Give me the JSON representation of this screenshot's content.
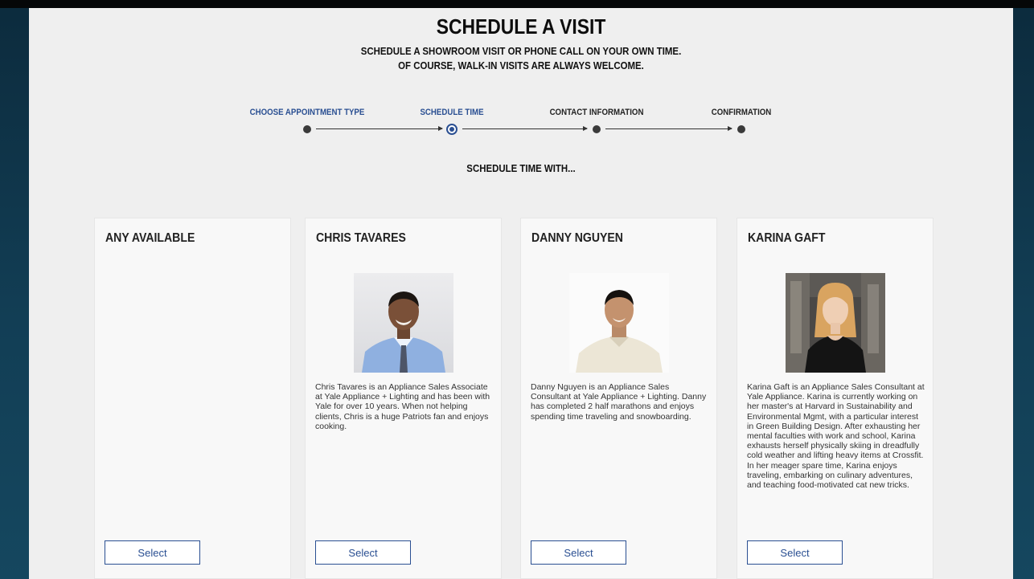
{
  "header": {
    "title": "SCHEDULE A VISIT",
    "subtitle_line1": "SCHEDULE A SHOWROOM VISIT OR PHONE CALL ON YOUR OWN TIME.",
    "subtitle_line2": "OF COURSE, WALK-IN VISITS ARE ALWAYS WELCOME."
  },
  "steps": [
    {
      "label": "CHOOSE APPOINTMENT TYPE",
      "state": "completed"
    },
    {
      "label": "SCHEDULE TIME",
      "state": "current"
    },
    {
      "label": "CONTACT INFORMATION",
      "state": "upcoming"
    },
    {
      "label": "CONFIRMATION",
      "state": "upcoming"
    }
  ],
  "section_heading": "SCHEDULE TIME WITH...",
  "cards": [
    {
      "name": "ANY AVAILABLE",
      "bio": "",
      "button": "Select",
      "photo": "none"
    },
    {
      "name": "CHRIS TAVARES",
      "bio": "Chris Tavares is an Appliance Sales Associate at Yale Appliance + Lighting and has been with Yale for over 10 years. When not helping clients, Chris is a huge Patriots fan and enjoys cooking.",
      "button": "Select",
      "photo": "portrait-light-background"
    },
    {
      "name": "DANNY NGUYEN",
      "bio": "Danny Nguyen is an Appliance Sales Consultant at Yale Appliance + Lighting. Danny has completed 2 half marathons and enjoys spending time traveling and snowboarding.",
      "button": "Select",
      "photo": "portrait-white-background"
    },
    {
      "name": "KARINA GAFT",
      "bio": "Karina Gaft is an Appliance Sales Consultant at Yale Appliance. Karina is currently working on her master's at Harvard in Sustainability and Environmental Mgmt, with a particular interest in Green Building Design. After exhausting her mental faculties with work and school, Karina exhausts herself physically skiing in dreadfully cold weather and lifting heavy items at Crossfit. In her meager spare time, Karina enjoys traveling, embarking on culinary adventures, and teaching food-motivated cat new tricks.",
      "button": "Select",
      "photo": "portrait-showroom-background"
    }
  ],
  "colors": {
    "accent": "#2a4f92",
    "page_background": "#efefef",
    "card_background": "#f8f8f8",
    "outer_background": "#123e55"
  }
}
